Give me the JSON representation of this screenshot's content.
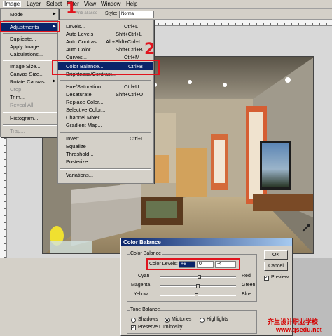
{
  "menubar": {
    "items": [
      "Image",
      "Layer",
      "Select",
      "Filter",
      "View",
      "Window",
      "Help"
    ]
  },
  "options_bar": {
    "grayed_text": "Anti-aliased",
    "style_label": "Style:",
    "style_value": "Normal"
  },
  "image_menu": {
    "items": [
      {
        "label": "Mode",
        "submenu": true
      },
      {
        "label": "Adjustments",
        "submenu": true,
        "highlighted": true
      },
      {
        "label": "Duplicate..."
      },
      {
        "label": "Apply Image..."
      },
      {
        "label": "Calculations..."
      },
      {
        "label": "Image Size..."
      },
      {
        "label": "Canvas Size..."
      },
      {
        "label": "Rotate Canvas",
        "submenu": true
      },
      {
        "label": "Crop",
        "disabled": true
      },
      {
        "label": "Trim..."
      },
      {
        "label": "Reveal All",
        "disabled": true
      },
      {
        "label": "Histogram..."
      },
      {
        "label": "Trap...",
        "disabled": true
      }
    ]
  },
  "adjust_menu": {
    "items": [
      {
        "label": "Levels...",
        "shortcut": "Ctrl+L"
      },
      {
        "label": "Auto Levels",
        "shortcut": "Shft+Ctrl+L"
      },
      {
        "label": "Auto Contrast",
        "shortcut": "Alt+Shft+Ctrl+L"
      },
      {
        "label": "Auto Color",
        "shortcut": "Shft+Ctrl+B"
      },
      {
        "label": "Curves...",
        "shortcut": "Ctrl+M"
      },
      {
        "label": "Color Balance...",
        "shortcut": "Ctrl+B",
        "highlighted": true
      },
      {
        "label": "Brightness/Contrast..."
      },
      {
        "label": "Hue/Saturation...",
        "shortcut": "Ctrl+U"
      },
      {
        "label": "Desaturate",
        "shortcut": "Shft+Ctrl+U"
      },
      {
        "label": "Replace Color..."
      },
      {
        "label": "Selective Color..."
      },
      {
        "label": "Channel Mixer..."
      },
      {
        "label": "Gradient Map..."
      },
      {
        "label": "Invert",
        "shortcut": "Ctrl+I"
      },
      {
        "label": "Equalize"
      },
      {
        "label": "Threshold..."
      },
      {
        "label": "Posterize..."
      },
      {
        "label": "Variations..."
      }
    ]
  },
  "annotations": [
    "1",
    "2",
    "3"
  ],
  "dialog": {
    "title": "Color Balance",
    "group_label": "Color Balance",
    "levels_label": "Color Levels:",
    "levels": [
      "+8",
      "0",
      "-4"
    ],
    "sliders": [
      {
        "left": "Cyan",
        "right": "Red",
        "value": 8
      },
      {
        "left": "Magenta",
        "right": "Green",
        "value": 0
      },
      {
        "left": "Yellow",
        "right": "Blue",
        "value": -4
      }
    ],
    "ok": "OK",
    "cancel": "Cancel",
    "preview": "Preview",
    "tone_label": "Tone Balance",
    "tones": [
      "Shadows",
      "Midtones",
      "Highlights"
    ],
    "selected_tone": "Midtones",
    "preserve": "Preserve Luminosity"
  },
  "watermark": {
    "line1": "齐生设计职业学校",
    "line2": "www.qsedu.net"
  },
  "colors": {
    "menu_highlight": "#0a246a",
    "annotation_red": "#e0141e"
  }
}
